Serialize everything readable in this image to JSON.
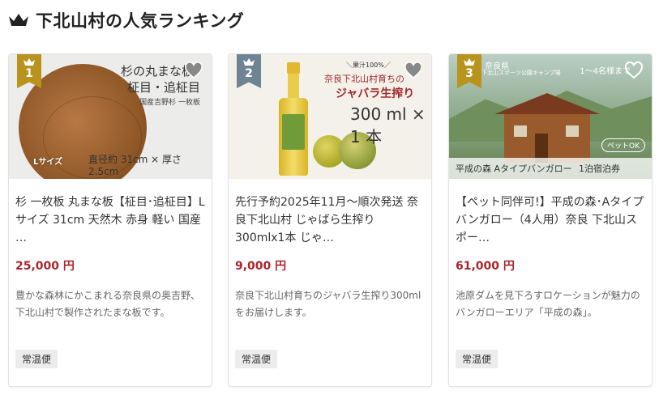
{
  "header": {
    "title": "下北山村の人気ランキング",
    "icon": "crown-icon"
  },
  "colors": {
    "gold": "#b8931e",
    "silver": "#6e8494",
    "price": "#a7262a",
    "badge_bg": "#ececec"
  },
  "cards": [
    {
      "rank": "1",
      "image_text": {
        "t1": "杉の丸まな板",
        "t2": "柾目・追柾目",
        "t3": "国産吉野杉 一枚板",
        "t4": "Lサイズ",
        "t5": "直径約 31cm × 厚さ 2.5cm"
      },
      "name": "杉 一枚板 丸まな板【柾目･追柾目】Lサイズ 31cm 天然木 赤身 軽い 国産 …",
      "price": "25,000 円",
      "description": "豊かな森林にかこまれる奈良県の奥吉野、下北山村で製作されたまな板です。",
      "shipping": "常温便"
    },
    {
      "rank": "2",
      "image_text": {
        "t1": "＼果汁100%／",
        "t2": "奈良下北山村育ちの",
        "t3": "ジャバラ生搾り",
        "t4": "300 ml × 1 本"
      },
      "name": "先行予約2025年11月～順次発送 奈良下北山村 じゃばら生搾り 300mlx1本 じゃ…",
      "price": "9,000 円",
      "description": "奈良下北山村育ちのジャバラ生搾り300mlをお届けします。",
      "shipping": "常温便"
    },
    {
      "rank": "3",
      "image_text": {
        "t1": "奈良県",
        "t2": "下北山スポーツ公園キャンプ場",
        "t3": "1～4名様まで",
        "t4": "平成の森 Aタイプバンガロー",
        "t5": "1泊宿泊券",
        "tag": "ペットOK"
      },
      "name": "【ペット同伴可!】平成の森･Aタイプバンガロー（4人用）奈良 下北山スポー…",
      "price": "61,000 円",
      "description": "池原ダムを見下ろすロケーションが魅力のバンガローエリア「平成の森」。",
      "shipping": "常温便"
    }
  ]
}
